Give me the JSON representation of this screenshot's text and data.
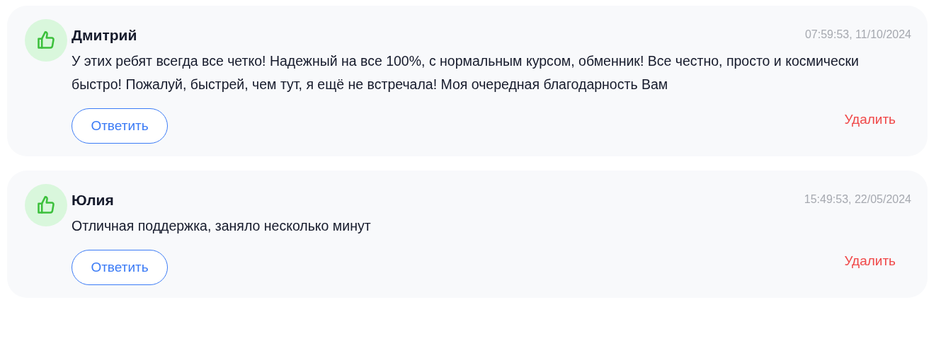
{
  "reviews": [
    {
      "author": "Дмитрий",
      "time": "07:59:53, 11/10/2024",
      "text": "У этих ребят всегда все четко! Надежный на все 100%, с нормальным курсом, обменник! Все честно, просто и космически быстро! Пожалуй, быстрей, чем тут, я ещё не встречала! Моя очередная благодарность Вам",
      "reply": "Ответить",
      "delete": "Удалить"
    },
    {
      "author": "Юлия",
      "time": "15:49:53, 22/05/2024",
      "text": "Отличная поддержка, заняло несколько минут",
      "reply": "Ответить",
      "delete": "Удалить"
    }
  ]
}
